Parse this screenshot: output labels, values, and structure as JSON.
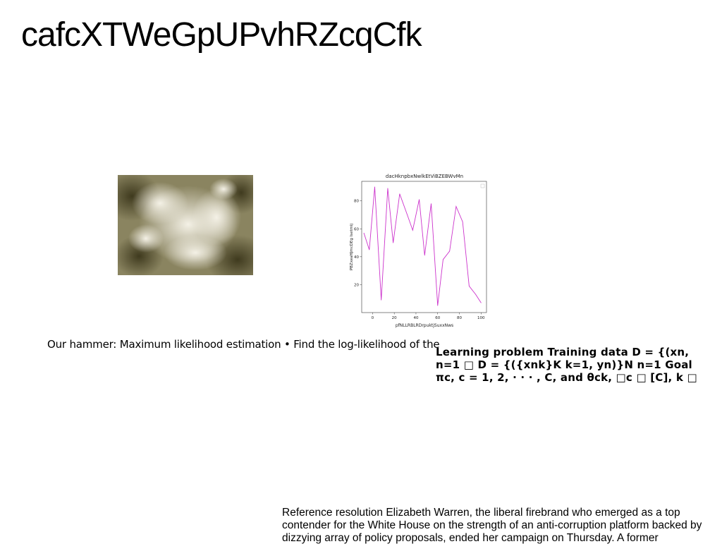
{
  "page": {
    "title": "cafcXTWeGpUPvhRZcqCfk",
    "caption": "Our hammer: Maximum likelihood estimation • Find the log-likelihood of the",
    "math_lines": [
      "Learning problem Training data D = {(xn,",
      "n=1 □ D = {({xnk}K k=1, yn)}N n=1 Goal",
      "πc, c = 1, 2, · · · , C, and θck, □c □ [C], k □"
    ],
    "reference_lines": [
      "Reference resolution Elizabeth Warren, the liberal firebrand who emerged as a top",
      "contender for the White House on the strength of an anti-corruption platform backed by",
      "dizzying array of policy proposals, ended her campaign on Thursday. A former"
    ]
  },
  "chart_data": {
    "type": "line",
    "title": "dacHknpbxNwlkEtViBZEBWvMn",
    "xlabel": "pfNLLRBLRDrpuktjSuxxNws",
    "ylabel": "PBZxeaHJmcDEg IsetmIj",
    "x_ticks": [
      "0",
      "20",
      "40",
      "60",
      "80",
      "100"
    ],
    "y_ticks": [
      "20",
      "40",
      "60",
      "80"
    ],
    "xlim": [
      -10,
      105
    ],
    "ylim": [
      0,
      94
    ],
    "series": [
      {
        "color": "#cc33cc",
        "x": [
          -8,
          -3,
          2,
          8,
          14,
          19,
          25,
          32,
          37,
          43,
          48,
          54,
          60,
          65,
          71,
          77,
          83,
          89,
          95,
          100
        ],
        "y": [
          57,
          45,
          90,
          9,
          89,
          50,
          85,
          70,
          59,
          81,
          41,
          78,
          5,
          38,
          44,
          76,
          65,
          19,
          13,
          7
        ]
      }
    ]
  }
}
